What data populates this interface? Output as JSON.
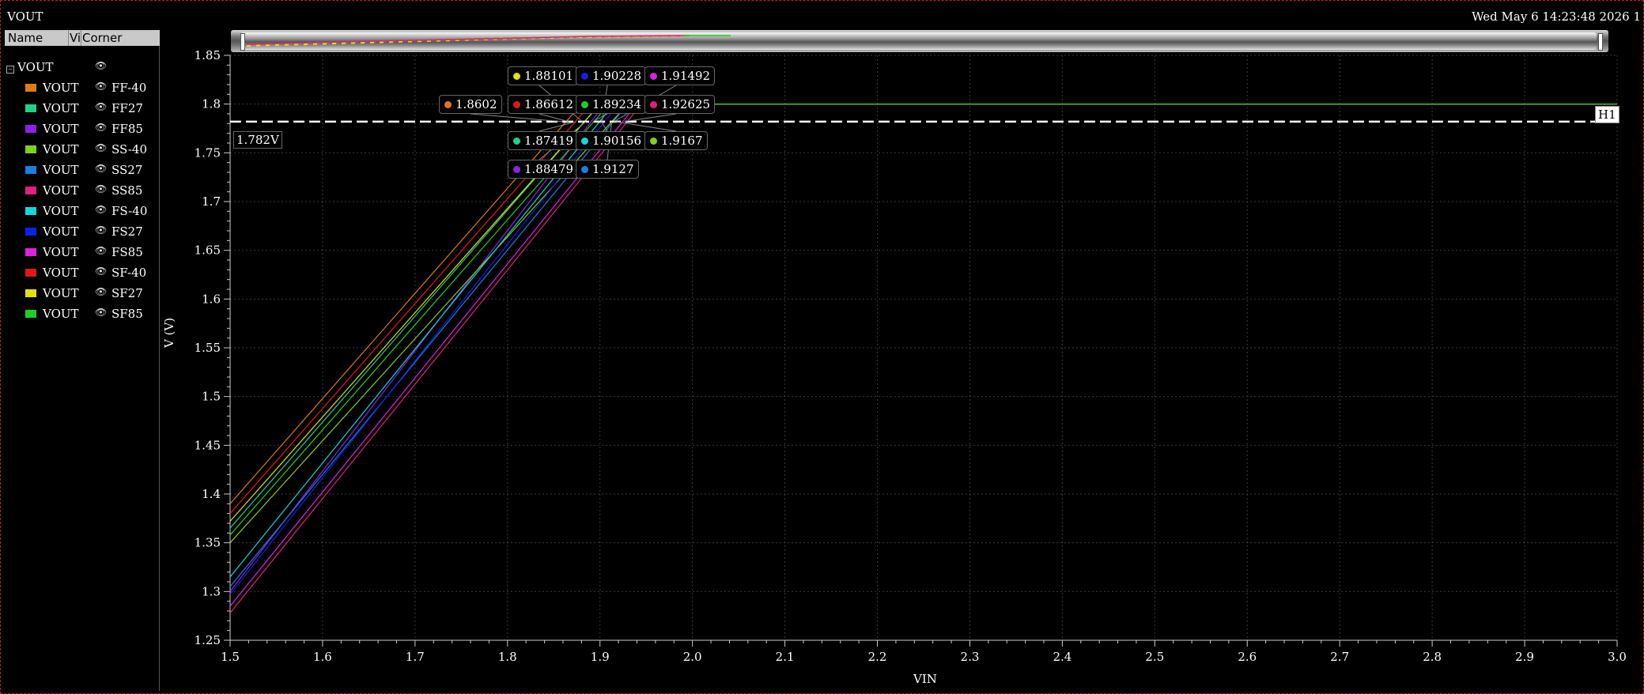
{
  "window": {
    "title": "VOUT",
    "date": "Wed May 6 14:23:48 2026  1"
  },
  "legend": {
    "headers": {
      "name": "Name",
      "vis": "Vis",
      "corner": "Corner"
    },
    "group": "VOUT",
    "items": [
      {
        "name": "VOUT",
        "corner": "FF-40",
        "color": "#e07a10"
      },
      {
        "name": "VOUT",
        "corner": "FF27",
        "color": "#20d08a"
      },
      {
        "name": "VOUT",
        "corner": "FF85",
        "color": "#9020e8"
      },
      {
        "name": "VOUT",
        "corner": "SS-40",
        "color": "#80d020"
      },
      {
        "name": "VOUT",
        "corner": "SS27",
        "color": "#1a80e0"
      },
      {
        "name": "VOUT",
        "corner": "SS85",
        "color": "#e0207a"
      },
      {
        "name": "VOUT",
        "corner": "FS-40",
        "color": "#10d8d8"
      },
      {
        "name": "VOUT",
        "corner": "FS27",
        "color": "#1020e8"
      },
      {
        "name": "VOUT",
        "corner": "FS85",
        "color": "#e020e0"
      },
      {
        "name": "VOUT",
        "corner": "SF-40",
        "color": "#e01818"
      },
      {
        "name": "VOUT",
        "corner": "SF27",
        "color": "#e0e010"
      },
      {
        "name": "VOUT",
        "corner": "SF85",
        "color": "#20d020"
      }
    ]
  },
  "horizontal_marker": {
    "name": "H1",
    "value_label": "1.782V",
    "value": 1.782
  },
  "chart_data": {
    "type": "line",
    "xlabel": "VIN",
    "ylabel": "V (V)",
    "xlim": [
      1.5,
      3.0
    ],
    "ylim": [
      1.25,
      1.85
    ],
    "x_ticks": [
      "1.5",
      "1.6",
      "1.7",
      "1.8",
      "1.9",
      "2.0",
      "2.1",
      "2.2",
      "2.3",
      "2.4",
      "2.5",
      "2.6",
      "2.7",
      "2.8",
      "2.9",
      "3.0"
    ],
    "y_ticks": [
      "1.25",
      "1.3",
      "1.35",
      "1.4",
      "1.45",
      "1.5",
      "1.55",
      "1.6",
      "1.65",
      "1.7",
      "1.75",
      "1.8",
      "1.85"
    ],
    "grid": true,
    "series": [
      {
        "name": "VOUT FF-40",
        "color": "#e07a10",
        "x": [
          1.5,
          1.88,
          3.0
        ],
        "y": [
          1.39,
          1.8,
          1.8
        ]
      },
      {
        "name": "VOUT FF27",
        "color": "#20d08a",
        "x": [
          1.5,
          1.9,
          3.0
        ],
        "y": [
          1.365,
          1.8,
          1.8
        ]
      },
      {
        "name": "VOUT FF85",
        "color": "#9020e8",
        "x": [
          1.5,
          1.905,
          3.0
        ],
        "y": [
          1.3,
          1.8,
          1.8
        ]
      },
      {
        "name": "VOUT SS-40",
        "color": "#80d020",
        "x": [
          1.5,
          1.93,
          3.0
        ],
        "y": [
          1.35,
          1.8,
          1.8
        ]
      },
      {
        "name": "VOUT SS27",
        "color": "#1a80e0",
        "x": [
          1.5,
          1.93,
          3.0
        ],
        "y": [
          1.305,
          1.8,
          1.8
        ]
      },
      {
        "name": "VOUT SS85",
        "color": "#e0207a",
        "x": [
          1.5,
          1.945,
          3.0
        ],
        "y": [
          1.278,
          1.8,
          1.8
        ]
      },
      {
        "name": "VOUT FS-40",
        "color": "#10d8d8",
        "x": [
          1.5,
          1.915,
          3.0
        ],
        "y": [
          1.315,
          1.8,
          1.8
        ]
      },
      {
        "name": "VOUT FS27",
        "color": "#1020e8",
        "x": [
          1.5,
          1.92,
          3.0
        ],
        "y": [
          1.297,
          1.8,
          1.8
        ]
      },
      {
        "name": "VOUT FS85",
        "color": "#e020e0",
        "x": [
          1.5,
          1.94,
          3.0
        ],
        "y": [
          1.285,
          1.8,
          1.8
        ]
      },
      {
        "name": "VOUT SF-40",
        "color": "#e01818",
        "x": [
          1.5,
          1.89,
          3.0
        ],
        "y": [
          1.38,
          1.8,
          1.8
        ]
      },
      {
        "name": "VOUT SF27",
        "color": "#e0e010",
        "x": [
          1.5,
          1.9,
          3.0
        ],
        "y": [
          1.372,
          1.8,
          1.8
        ]
      },
      {
        "name": "VOUT SF85",
        "color": "#20d020",
        "x": [
          1.5,
          1.91,
          3.0
        ],
        "y": [
          1.358,
          1.8,
          1.8
        ]
      }
    ],
    "markers": [
      {
        "label": "1.88101",
        "color": "#e0e010"
      },
      {
        "label": "1.90228",
        "color": "#1020e8"
      },
      {
        "label": "1.91492",
        "color": "#e020e0"
      },
      {
        "label": "1.8602",
        "color": "#e07a10"
      },
      {
        "label": "1.86612",
        "color": "#e01818"
      },
      {
        "label": "1.89234",
        "color": "#20d020"
      },
      {
        "label": "1.92625",
        "color": "#e0207a"
      },
      {
        "label": "1.87419",
        "color": "#20d08a"
      },
      {
        "label": "1.90156",
        "color": "#10d8d8"
      },
      {
        "label": "1.9167",
        "color": "#80d020"
      },
      {
        "label": "1.88479",
        "color": "#9020e8"
      },
      {
        "label": "1.9127",
        "color": "#1a80e0"
      }
    ]
  }
}
